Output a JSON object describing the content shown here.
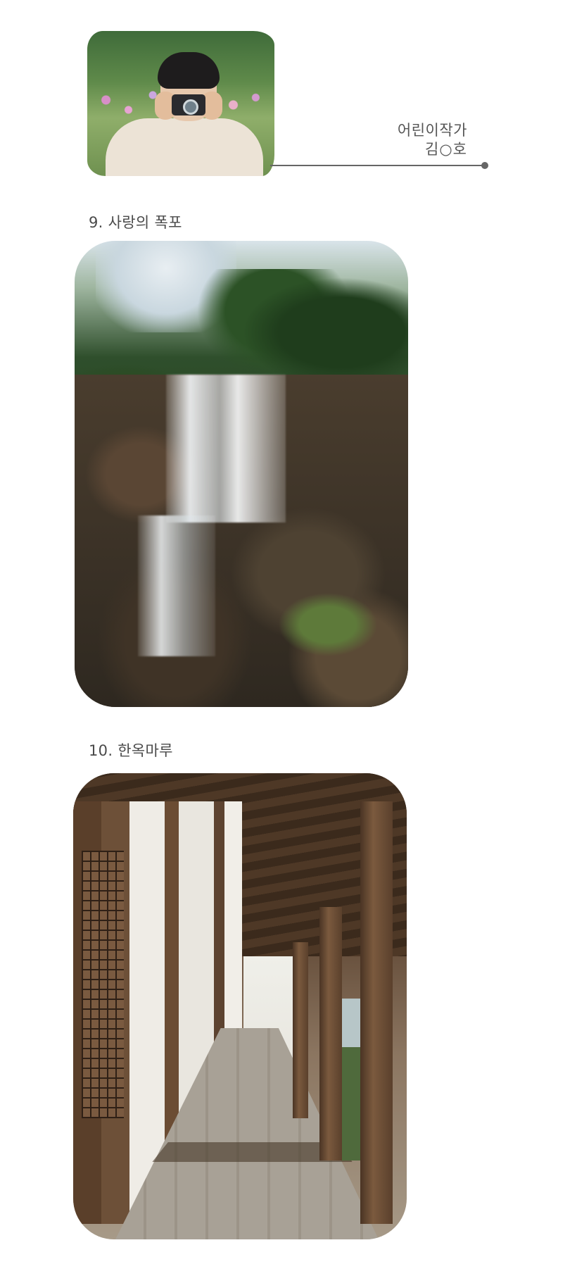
{
  "author": {
    "role": "어린이작가",
    "name": "김○호"
  },
  "sections": [
    {
      "caption": "9. 사랑의 폭포"
    },
    {
      "caption": "10. 한옥마루"
    }
  ]
}
